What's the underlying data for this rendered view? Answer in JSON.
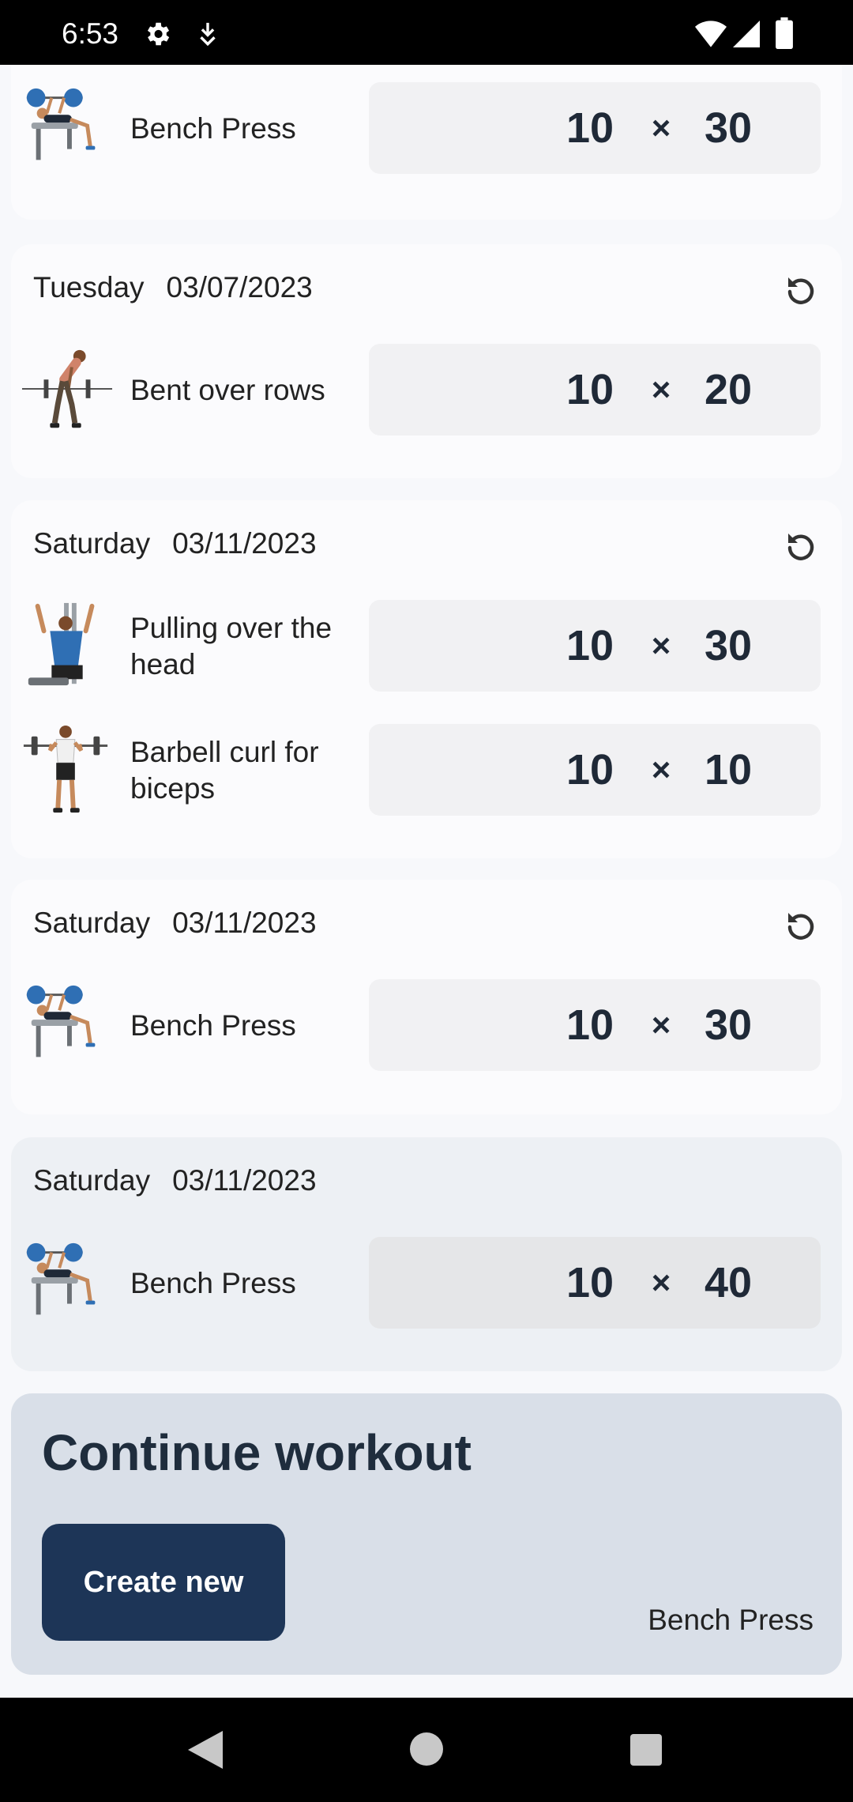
{
  "status_bar": {
    "time": "6:53"
  },
  "workouts": [
    {
      "exercises": [
        {
          "name": "Bench Press",
          "image": "bench-press-icon",
          "reps": "10",
          "weight": "30"
        }
      ]
    },
    {
      "day": "Tuesday",
      "date": "03/07/2023",
      "exercises": [
        {
          "name": "Bent over rows",
          "image": "bent-over-rows-icon",
          "reps": "10",
          "weight": "20"
        }
      ]
    },
    {
      "day": "Saturday",
      "date": "03/11/2023",
      "exercises": [
        {
          "name": "Pulling over the head",
          "image": "pulldown-icon",
          "reps": "10",
          "weight": "30"
        },
        {
          "name": "Barbell curl for biceps",
          "image": "barbell-curl-icon",
          "reps": "10",
          "weight": "10"
        }
      ]
    },
    {
      "day": "Saturday",
      "date": "03/11/2023",
      "exercises": [
        {
          "name": "Bench Press",
          "image": "bench-press-icon",
          "reps": "10",
          "weight": "30"
        }
      ]
    },
    {
      "day": "Saturday",
      "date": "03/11/2023",
      "active": true,
      "exercises": [
        {
          "name": "Bench Press",
          "image": "bench-press-icon",
          "reps": "10",
          "weight": "40"
        }
      ]
    }
  ],
  "times_symbol": "×",
  "continue_panel": {
    "title": "Continue workout",
    "create_button": "Create new",
    "current_exercise": "Bench Press"
  },
  "colors": {
    "accent": "#1d3557",
    "panel": "#d9dfe8",
    "card": "#fbfbfd",
    "active_card": "#edf0f4"
  }
}
